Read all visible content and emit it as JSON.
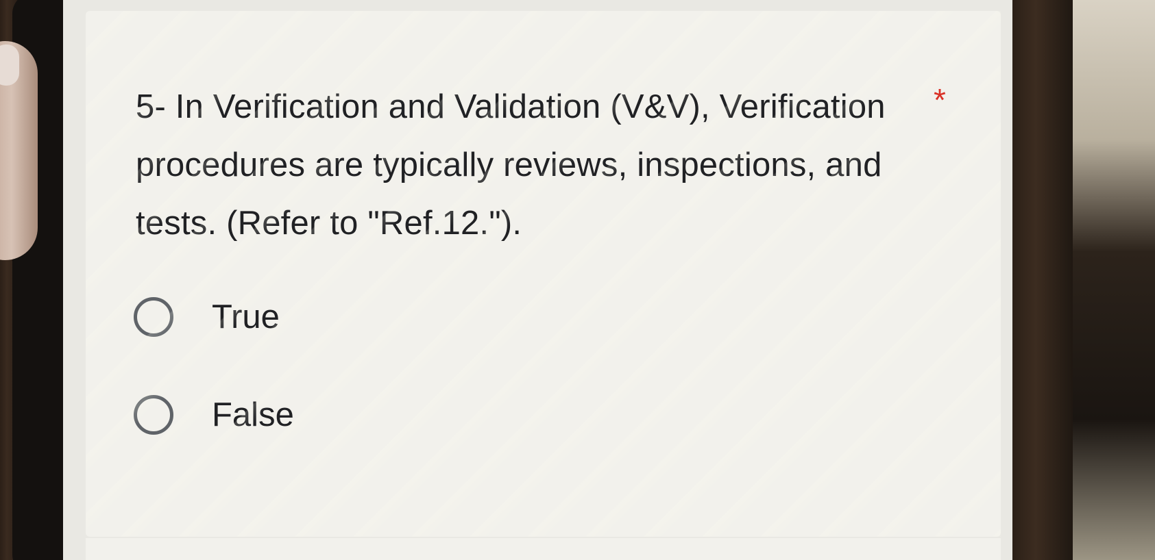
{
  "question": {
    "text": "5- In Verification and Validation (V&V), Verification procedures are typically reviews, inspections, and tests. (Refer to \"Ref.12.\").",
    "required_marker": "*"
  },
  "options": [
    {
      "label": "True",
      "selected": false
    },
    {
      "label": "False",
      "selected": false
    }
  ],
  "colors": {
    "required": "#d93025",
    "radio_border": "#5f6368",
    "text": "#202124"
  }
}
